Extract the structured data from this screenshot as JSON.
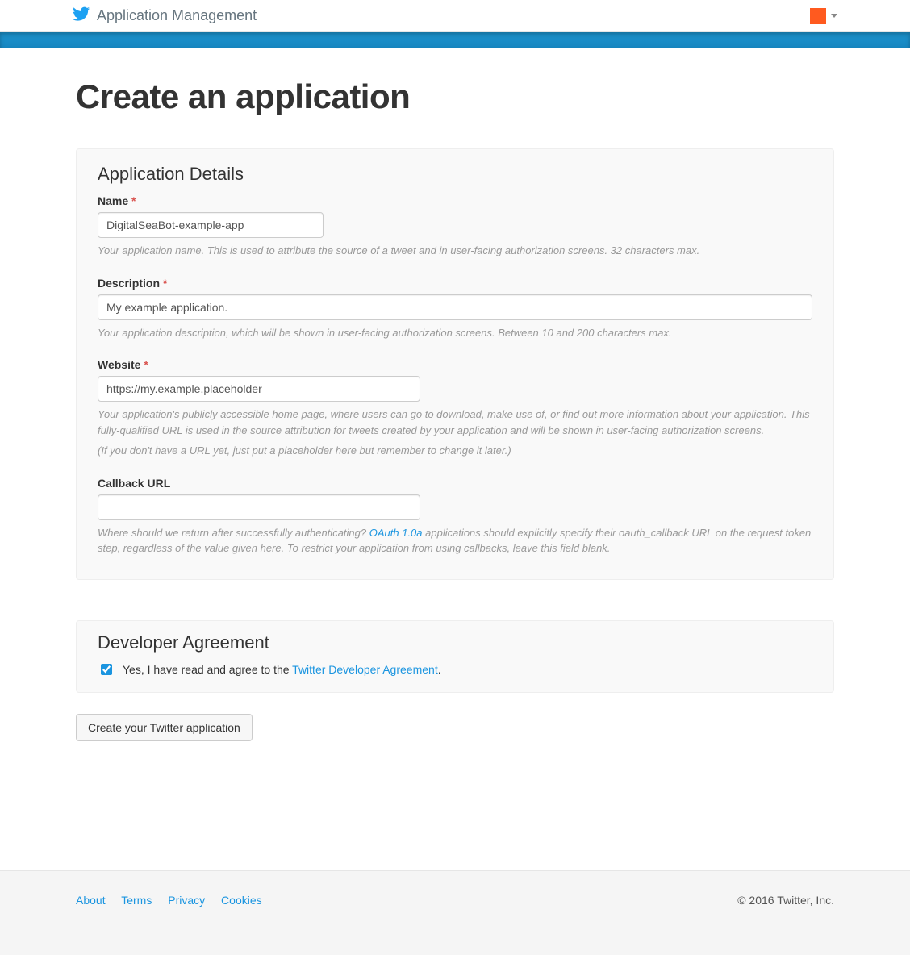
{
  "header": {
    "brand": "Application Management"
  },
  "page": {
    "title": "Create an application"
  },
  "details": {
    "heading": "Application Details",
    "name": {
      "label": "Name",
      "required": "*",
      "value": "DigitalSeaBot-example-app",
      "help": "Your application name. This is used to attribute the source of a tweet and in user-facing authorization screens. 32 characters max."
    },
    "description": {
      "label": "Description",
      "required": "*",
      "value": "My example application.",
      "help": "Your application description, which will be shown in user-facing authorization screens. Between 10 and 200 characters max."
    },
    "website": {
      "label": "Website",
      "required": "*",
      "value": "https://my.example.placeholder",
      "help1": "Your application's publicly accessible home page, where users can go to download, make use of, or find out more information about your application. This fully-qualified URL is used in the source attribution for tweets created by your application and will be shown in user-facing authorization screens.",
      "help2": "(If you don't have a URL yet, just put a placeholder here but remember to change it later.)"
    },
    "callback": {
      "label": "Callback URL",
      "value": "",
      "help_pre": "Where should we return after successfully authenticating? ",
      "help_link": "OAuth 1.0a",
      "help_post": " applications should explicitly specify their oauth_callback URL on the request token step, regardless of the value given here. To restrict your application from using callbacks, leave this field blank."
    }
  },
  "agreement": {
    "heading": "Developer Agreement",
    "checked": true,
    "text_pre": "Yes, I have read and agree to the ",
    "link": "Twitter Developer Agreement",
    "text_post": "."
  },
  "submit": {
    "label": "Create your Twitter application"
  },
  "footer": {
    "links": {
      "about": "About",
      "terms": "Terms",
      "privacy": "Privacy",
      "cookies": "Cookies"
    },
    "copyright": "© 2016 Twitter, Inc."
  }
}
